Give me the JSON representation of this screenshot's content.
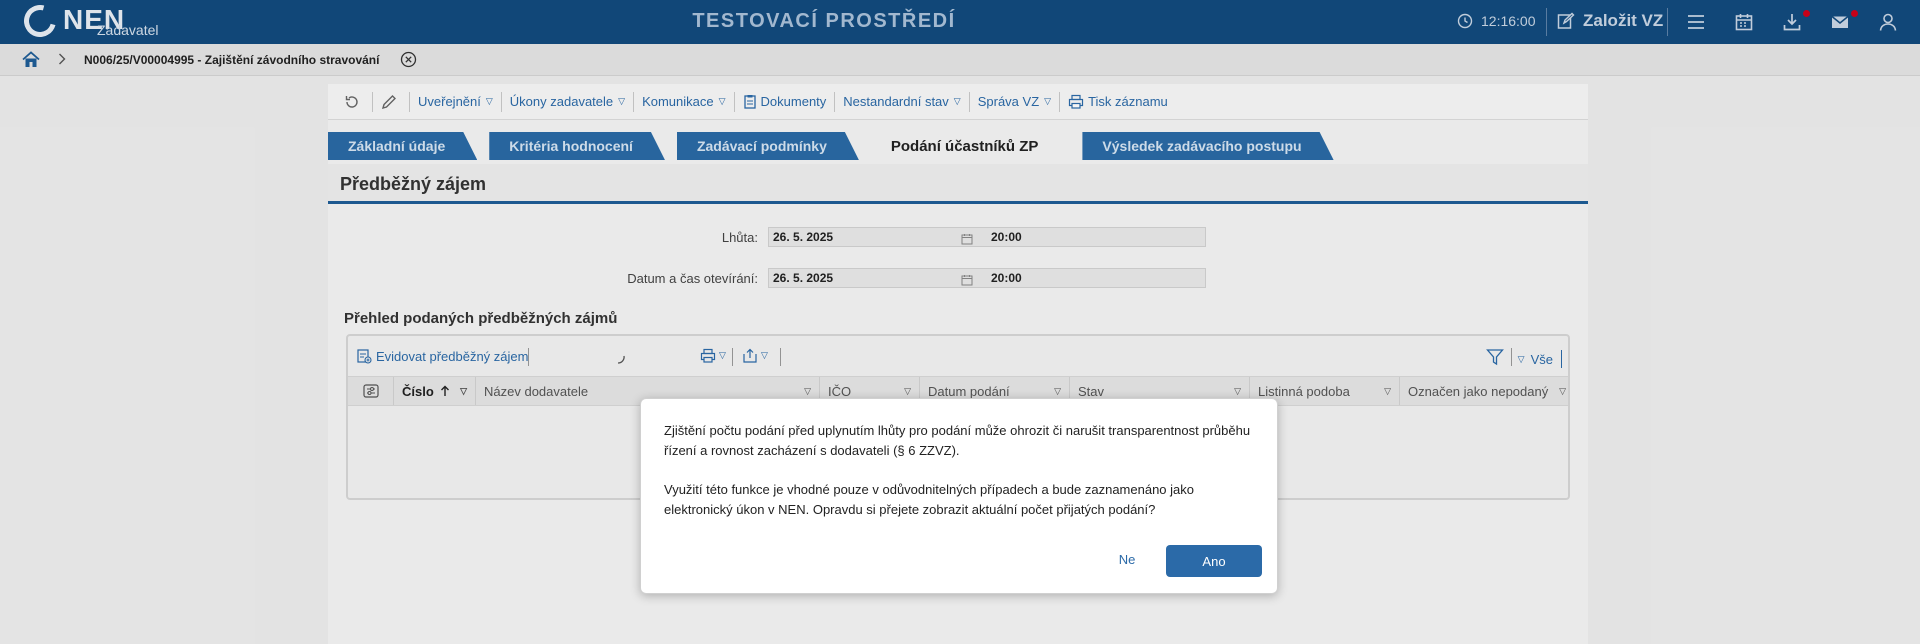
{
  "header": {
    "logo_text": "NEN",
    "logo_subtitle": "Zadavatel",
    "environment_title": "TESTOVACÍ PROSTŘEDÍ",
    "clock": "12:16:00",
    "new_vz_label": "Založit VZ",
    "icons": [
      "clock-icon",
      "edit-icon",
      "menu-icon",
      "calendar-icon",
      "download-icon",
      "mail-icon",
      "user-icon"
    ],
    "brand_color": "#124a7d",
    "notification_color": "#d0021b"
  },
  "breadcrumb": {
    "title": "N006/25/V00004995 - Zajištění závodního stravování"
  },
  "toolbar": {
    "items": [
      {
        "label": "Uveřejnění"
      },
      {
        "label": "Úkony zadavatele"
      },
      {
        "label": "Komunikace"
      },
      {
        "label": "Dokumenty"
      },
      {
        "label": "Nestandardní stav"
      },
      {
        "label": "Správa VZ"
      },
      {
        "label": "Tisk záznamu"
      }
    ]
  },
  "tabs": [
    {
      "label": "Základní údaje"
    },
    {
      "label": "Kritéria hodnocení"
    },
    {
      "label": "Zadávací podmínky"
    },
    {
      "label": "Podání účastníků ZP"
    },
    {
      "label": "Výsledek zadávacího postupu"
    }
  ],
  "active_tab": "Podání účastníků ZP",
  "section": {
    "title": "Předběžný zájem"
  },
  "form": {
    "deadline_label": "Lhůta:",
    "deadline_date": "26. 5. 2025",
    "deadline_time": "20:00",
    "opening_label": "Datum a čas otevírání:",
    "opening_date": "26. 5. 2025",
    "opening_time": "20:00"
  },
  "grid": {
    "title": "Přehled podaných předběžných zájmů",
    "add_label": "Evidovat předběžný zájem",
    "filter_all_label": "Vše",
    "columns": [
      "Číslo",
      "Název dodavatele",
      "IČO",
      "Datum podání",
      "Stav",
      "Listinná podoba",
      "Označen jako nepodaný"
    ]
  },
  "dialog": {
    "paragraph1": "Zjištění počtu podání před uplynutím lhůty pro podání může ohrozit či narušit transparentnost průběhu řízení a rovnost zacházení s dodavateli (§ 6 ZZVZ).",
    "paragraph2": "Využití této funkce je vhodné pouze v odůvodnitelných případech a bude zaznamenáno jako elektronický úkon v NEN. Opravdu si přejete zobrazit aktuální počet přijatých podání?",
    "no_label": "Ne",
    "yes_label": "Ano",
    "accent_color": "#2b6aa8"
  }
}
